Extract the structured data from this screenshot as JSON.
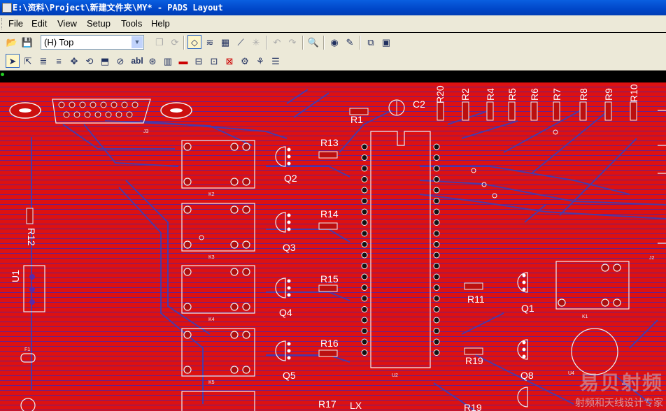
{
  "window": {
    "title": "E:\\资料\\Project\\新建文件夹\\MY* - PADS Layout"
  },
  "menu": {
    "file": "File",
    "edit": "Edit",
    "view": "View",
    "setup": "Setup",
    "tools": "Tools",
    "help": "Help"
  },
  "toolbar": {
    "layer_value": "(H) Top"
  },
  "board": {
    "refs": {
      "R1": "R1",
      "R2": "R2",
      "R4": "R4",
      "R5": "R5",
      "R6": "R6",
      "R7": "R7",
      "R8": "R8",
      "R9": "R9",
      "R10": "R10",
      "R11": "R11",
      "R12": "R12",
      "R13": "R13",
      "R14": "R14",
      "R15": "R15",
      "R16": "R16",
      "R17": "R17",
      "R19": "R19",
      "R19b": "R19",
      "R20": "R20",
      "C2": "C2",
      "Q1": "Q1",
      "Q2": "Q2",
      "Q3": "Q3",
      "Q4": "Q4",
      "Q5": "Q5",
      "Q8": "Q8",
      "U1": "U1",
      "LX": "LX",
      "J3": "J3",
      "K1": "K1",
      "K2": "K2",
      "K3": "K3",
      "K4": "K4",
      "K5": "K5",
      "U2": "U2",
      "J2": "J2",
      "U4": "U4",
      "F1": "F1"
    }
  },
  "watermark": {
    "line1": "易贝射频",
    "line2": "射频和天线设计专家"
  },
  "colors": {
    "board": "#dd1111",
    "trace": "#4a3aa8",
    "outline": "#f0f0f0",
    "titlebar": "#0054e3",
    "chrome": "#ece9d8"
  },
  "icons": {
    "open": "folder-open-icon",
    "save": "save-icon",
    "select": "arrow-select-icon",
    "zoom": "magnifier-icon"
  }
}
